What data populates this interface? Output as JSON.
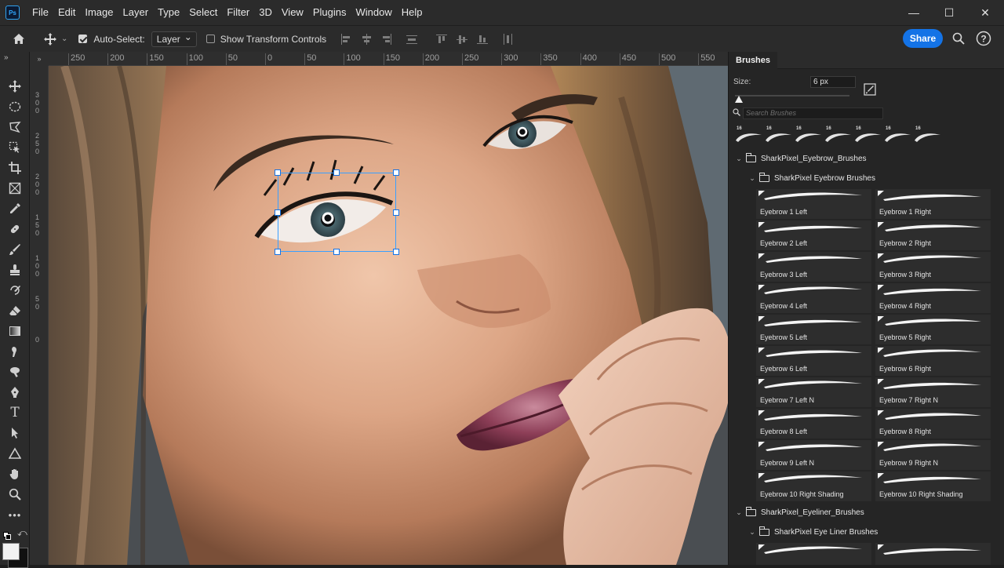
{
  "app": {
    "logo": "Ps"
  },
  "menu": [
    "File",
    "Edit",
    "Image",
    "Layer",
    "Type",
    "Select",
    "Filter",
    "3D",
    "View",
    "Plugins",
    "Window",
    "Help"
  ],
  "window_controls": {
    "minimize": "—",
    "maximize": "☐",
    "close": "✕"
  },
  "options": {
    "auto_select_label": "Auto-Select:",
    "auto_select_checked": true,
    "auto_select_target": "Layer",
    "show_transform_label": "Show Transform Controls",
    "show_transform_checked": false,
    "share_label": "Share"
  },
  "rulers": {
    "horizontal": [
      "250",
      "200",
      "150",
      "100",
      "50",
      "0",
      "50",
      "100",
      "150",
      "200",
      "250",
      "300",
      "350",
      "400",
      "450",
      "500",
      "550"
    ],
    "vertical": [
      "300",
      "250",
      "200",
      "150",
      "100",
      "50",
      "0"
    ],
    "corner": "»"
  },
  "tools": [
    "move-tool",
    "marquee-tool",
    "lasso-tool",
    "object-select-tool",
    "crop-tool",
    "frame-tool",
    "eyedropper-tool",
    "healing-tool",
    "brush-tool",
    "stamp-tool",
    "history-brush-tool",
    "eraser-tool",
    "gradient-tool",
    "smudge-tool",
    "dodge-tool",
    "pen-tool",
    "type-tool",
    "path-select-tool",
    "shape-tool",
    "hand-tool",
    "zoom-tool",
    "more-tools"
  ],
  "brushes_panel": {
    "tab": "Brushes",
    "size_label": "Size:",
    "size_value": "6 px",
    "size_fraction": 0.0,
    "search_placeholder": "Search Brushes",
    "recent_brushes": [
      "16",
      "16",
      "16",
      "16",
      "16",
      "16",
      "16"
    ],
    "groups": [
      {
        "name": "SharkPixel_Eyebrow_Brushes",
        "subgroup": "SharkPixel Eyebrow Brushes",
        "brushes": [
          [
            "Eyebrow 1 Left",
            "Eyebrow 1 Right"
          ],
          [
            "Eyebrow 2 Left",
            "Eyebrow 2 Right"
          ],
          [
            "Eyebrow 3 Left",
            "Eyebrow 3 Right"
          ],
          [
            "Eyebrow 4 Left",
            "Eyebrow 4 Right"
          ],
          [
            "Eyebrow 5 Left",
            "Eyebrow 5 Right"
          ],
          [
            "Eyebrow 6 Left",
            "Eyebrow 6 Right"
          ],
          [
            "Eyebrow 7 Left N",
            "Eyebrow 7 Right N"
          ],
          [
            "Eyebrow 8 Left",
            "Eyebrow 8 Right"
          ],
          [
            "Eyebrow 9 Left N",
            "Eyebrow 9 Right N"
          ],
          [
            "Eyebrow 10 Right Shading",
            "Eyebrow 10 Right Shading"
          ]
        ]
      },
      {
        "name": "SharkPixel_Eyeliner_Brushes",
        "subgroup": "SharkPixel Eye Liner Brushes"
      }
    ]
  }
}
